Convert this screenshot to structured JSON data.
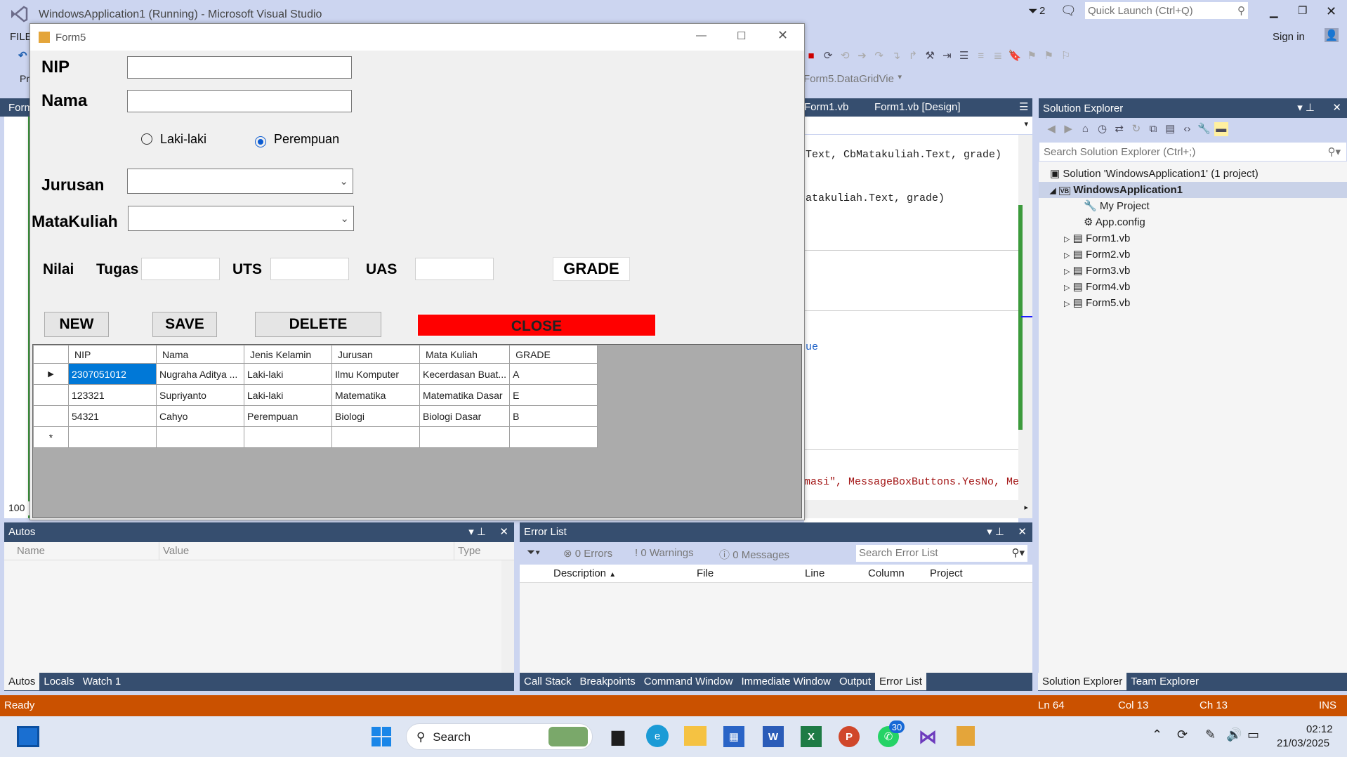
{
  "vs": {
    "title": "WindowsApplication1 (Running) - Microsoft Visual Studio",
    "notif_count": "2",
    "quick_launch_placeholder": "Quick Launch (Ctrl+Q)",
    "sign_in": "Sign in",
    "menu_first": "FILE",
    "toolbar_left_text": "Pr",
    "dropdown_text": "Form5.DataGridVie",
    "left_tab_fragment": "Form",
    "zoom_fragment": "100"
  },
  "doc_tabs": [
    "Form1.vb",
    "Form1.vb [Design]"
  ],
  "code_lines": [
    "Text, CbMatakuliah.Text, grade)",
    "atakuliah.Text, grade)",
    "ue",
    "masi\", MessageBoxButtons.YesNo, Me"
  ],
  "solution_explorer": {
    "title": "Solution Explorer",
    "search_placeholder": "Search Solution Explorer (Ctrl+;)",
    "solution": "Solution 'WindowsApplication1' (1 project)",
    "project": "WindowsApplication1",
    "items": [
      "My Project",
      "App.config",
      "Form1.vb",
      "Form2.vb",
      "Form3.vb",
      "Form4.vb",
      "Form5.vb"
    ],
    "bottom_tabs": [
      "Solution Explorer",
      "Team Explorer"
    ]
  },
  "autos": {
    "title": "Autos",
    "columns": [
      "Name",
      "Value",
      "Type"
    ],
    "tabs": [
      "Autos",
      "Locals",
      "Watch 1"
    ]
  },
  "error_list": {
    "title": "Error List",
    "errors": "0 Errors",
    "warnings": "0 Warnings",
    "messages": "0 Messages",
    "search_placeholder": "Search Error List",
    "columns": [
      "Description",
      "File",
      "Line",
      "Column",
      "Project"
    ],
    "tabs": [
      "Call Stack",
      "Breakpoints",
      "Command Window",
      "Immediate Window",
      "Output",
      "Error List"
    ]
  },
  "status": {
    "ready": "Ready",
    "ln": "Ln 64",
    "col": "Col 13",
    "ch": "Ch 13",
    "ins": "INS"
  },
  "taskbar": {
    "search": "Search",
    "whatsapp_badge": "30",
    "time": "02:12",
    "date": "21/03/2025"
  },
  "form5": {
    "title": "Form5",
    "nip_label": "NIP",
    "nama_label": "Nama",
    "radio_male": "Laki-laki",
    "radio_female": "Perempuan",
    "gender_selected": "Perempuan",
    "jurusan_label": "Jurusan",
    "matakuliah_label": "MataKuliah",
    "nilai_label": "Nilai",
    "tugas_label": "Tugas",
    "uts_label": "UTS",
    "uas_label": "UAS",
    "grade_label": "GRADE",
    "buttons": {
      "new": "NEW",
      "save": "SAVE",
      "delete": "DELETE",
      "close": "CLOSE"
    },
    "grid_columns": [
      "NIP",
      "Nama",
      "Jenis Kelamin",
      "Jurusan",
      "Mata Kuliah",
      "GRADE"
    ],
    "grid_rows": [
      [
        "2307051012",
        "Nugraha Aditya ...",
        "Laki-laki",
        "Ilmu Komputer",
        "Kecerdasan Buat...",
        "A"
      ],
      [
        "123321",
        "Supriyanto",
        "Laki-laki",
        "Matematika",
        "Matematika Dasar",
        "E"
      ],
      [
        "54321",
        "Cahyo",
        "Perempuan",
        "Biologi",
        "Biologi Dasar",
        "B"
      ]
    ]
  },
  "colors": {
    "accent": "#364e6f",
    "status_bar": "#ca5100",
    "close_button": "#ff0000",
    "selection": "#0078d7"
  }
}
